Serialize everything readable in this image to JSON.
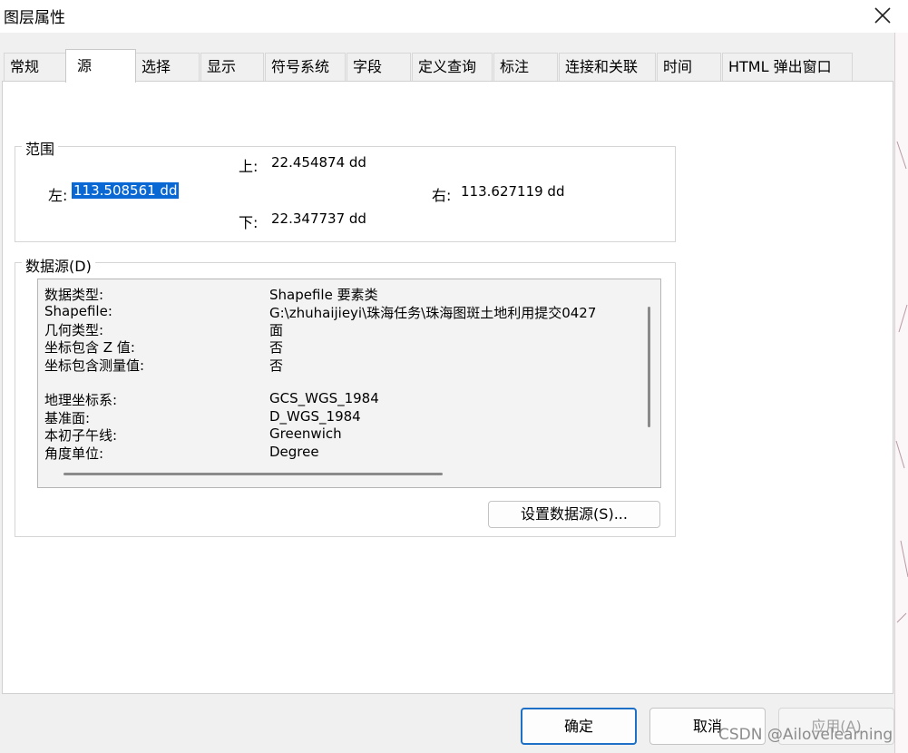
{
  "window": {
    "title": "图层属性",
    "close_icon": "close-icon"
  },
  "tabs": [
    {
      "label": "常规",
      "active": false
    },
    {
      "label": "源",
      "active": true
    },
    {
      "label": "选择",
      "active": false
    },
    {
      "label": "显示",
      "active": false
    },
    {
      "label": "符号系统",
      "active": false
    },
    {
      "label": "字段",
      "active": false
    },
    {
      "label": "定义查询",
      "active": false
    },
    {
      "label": "标注",
      "active": false
    },
    {
      "label": "连接和关联",
      "active": false
    },
    {
      "label": "时间",
      "active": false
    },
    {
      "label": "HTML 弹出窗口",
      "active": false
    }
  ],
  "extent": {
    "legend": "范围",
    "top_label": "上:",
    "top_value": "22.454874 dd",
    "left_label": "左:",
    "left_value": "113.508561 dd",
    "right_label": "右:",
    "right_value": "113.627119 dd",
    "bottom_label": "下:",
    "bottom_value": "22.347737 dd"
  },
  "data_source": {
    "legend": "数据源(D)",
    "rows": [
      {
        "key": "数据类型:",
        "value": "Shapefile 要素类"
      },
      {
        "key": "Shapefile:",
        "value": "G:\\zhuhaijieyi\\珠海任务\\珠海图斑土地利用提交0427"
      },
      {
        "key": "几何类型:",
        "value": "面"
      },
      {
        "key": "坐标包含 Z 值:",
        "value": "否"
      },
      {
        "key": "坐标包含测量值:",
        "value": "否"
      },
      {
        "key": "",
        "value": ""
      },
      {
        "key": "地理坐标系:",
        "value": "GCS_WGS_1984"
      },
      {
        "key": "基准面:",
        "value": "D_WGS_1984"
      },
      {
        "key": "本初子午线:",
        "value": "Greenwich"
      },
      {
        "key": "角度单位:",
        "value": "Degree"
      }
    ],
    "set_source_button": "设置数据源(S)..."
  },
  "footer": {
    "ok": "确定",
    "cancel": "取消",
    "apply": "应用(A)"
  },
  "watermark": "CSDN @Ailovelearning",
  "colors": {
    "selection": "#0a68d4",
    "primary_border": "#1e6fc6"
  }
}
